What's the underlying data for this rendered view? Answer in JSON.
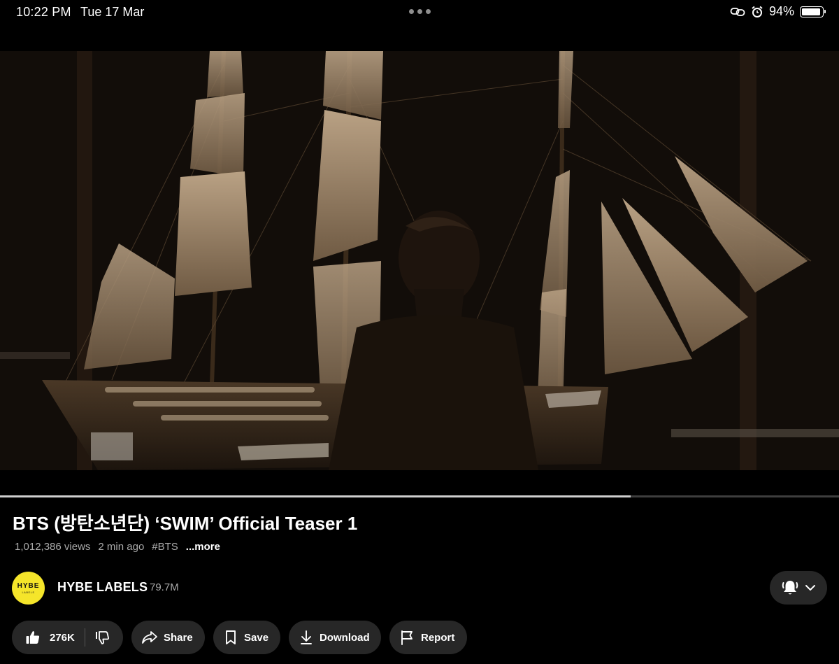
{
  "status_bar": {
    "time": "10:22 PM",
    "date": "Tue 17 Mar",
    "battery": "94%",
    "battery_level": 0.94
  },
  "video": {
    "progress": 0.752
  },
  "title": "BTS (방탄소년단) ‘SWIM’ Official Teaser 1",
  "meta": {
    "views": "1,012,386 views",
    "age": "2 min ago",
    "hashtag": "#BTS",
    "more": "...more"
  },
  "channel": {
    "name": "HYBE LABELS",
    "subscribers": "79.7M",
    "logo_text": "HYBE",
    "logo_sub": "LABELS"
  },
  "actions": {
    "likes": "276K",
    "share": "Share",
    "save": "Save",
    "download": "Download",
    "report": "Report"
  },
  "icons": [
    "link-icon",
    "alarm-icon",
    "battery-icon",
    "bell-icon",
    "chevron-down-icon",
    "thumbs-up-icon",
    "thumbs-down-icon",
    "share-icon",
    "bookmark-icon",
    "download-icon",
    "flag-icon"
  ],
  "colors": {
    "background": "#000000",
    "pill": "#272727",
    "secondary_text": "#aaaaaa",
    "avatar": "#f5e52a"
  }
}
